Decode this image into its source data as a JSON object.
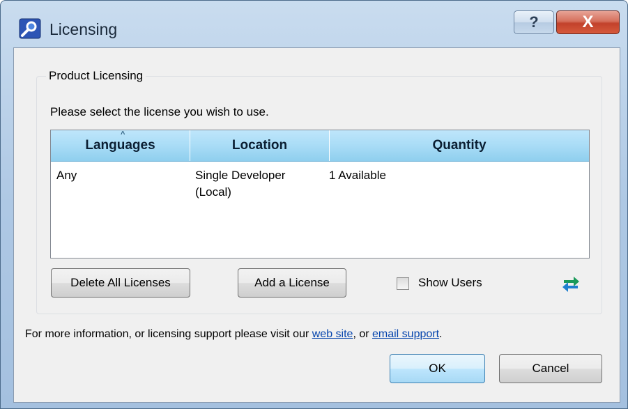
{
  "window": {
    "title": "Licensing",
    "help_label": "?",
    "close_label": "X"
  },
  "group": {
    "legend": "Product Licensing",
    "instruction": "Please select the license you wish to use."
  },
  "table": {
    "columns": [
      "Languages",
      "Location",
      "Quantity"
    ],
    "rows": [
      {
        "language": "Any",
        "location_line1": "Single Developer",
        "location_line2": "(Local)",
        "quantity": "1 Available"
      }
    ]
  },
  "actions": {
    "delete_all_label": "Delete All Licenses",
    "add_license_label": "Add a License",
    "show_users_label": "Show Users",
    "show_users_checked": false
  },
  "footer": {
    "text_before": "For more information, or licensing support please visit our ",
    "web_site_link": "web site",
    "text_middle": ", or ",
    "email_link": "email support",
    "text_after": "."
  },
  "buttons": {
    "ok_label": "OK",
    "cancel_label": "Cancel"
  },
  "colors": {
    "header_blue": "#a9dcf6",
    "close_red": "#c2412b",
    "link_blue": "#0645ad",
    "refresh_green": "#1a9a5a"
  }
}
